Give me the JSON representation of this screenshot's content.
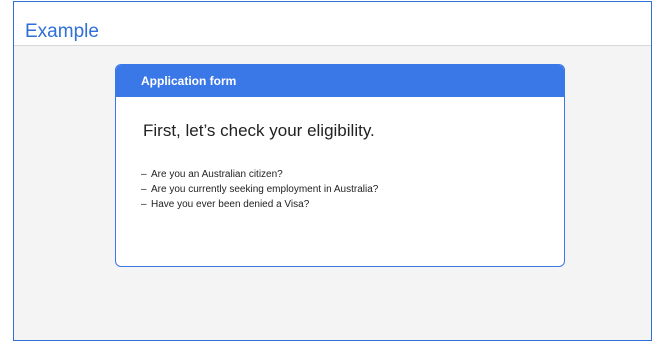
{
  "example": {
    "title": "Example"
  },
  "form": {
    "header_title": "Application form",
    "heading": "First, let’s check your eligibility.",
    "questions": [
      {
        "bullet": "–",
        "text": "Are you an Australian citizen?"
      },
      {
        "bullet": "–",
        "text": "Are you currently seeking employment in Australia?"
      },
      {
        "bullet": "–",
        "text": "Have you ever been denied a Visa?"
      }
    ]
  },
  "colors": {
    "accent": "#3b78e7",
    "frame_border": "#2f6fd6",
    "background": "#f4f4f4",
    "text": "#222222"
  }
}
